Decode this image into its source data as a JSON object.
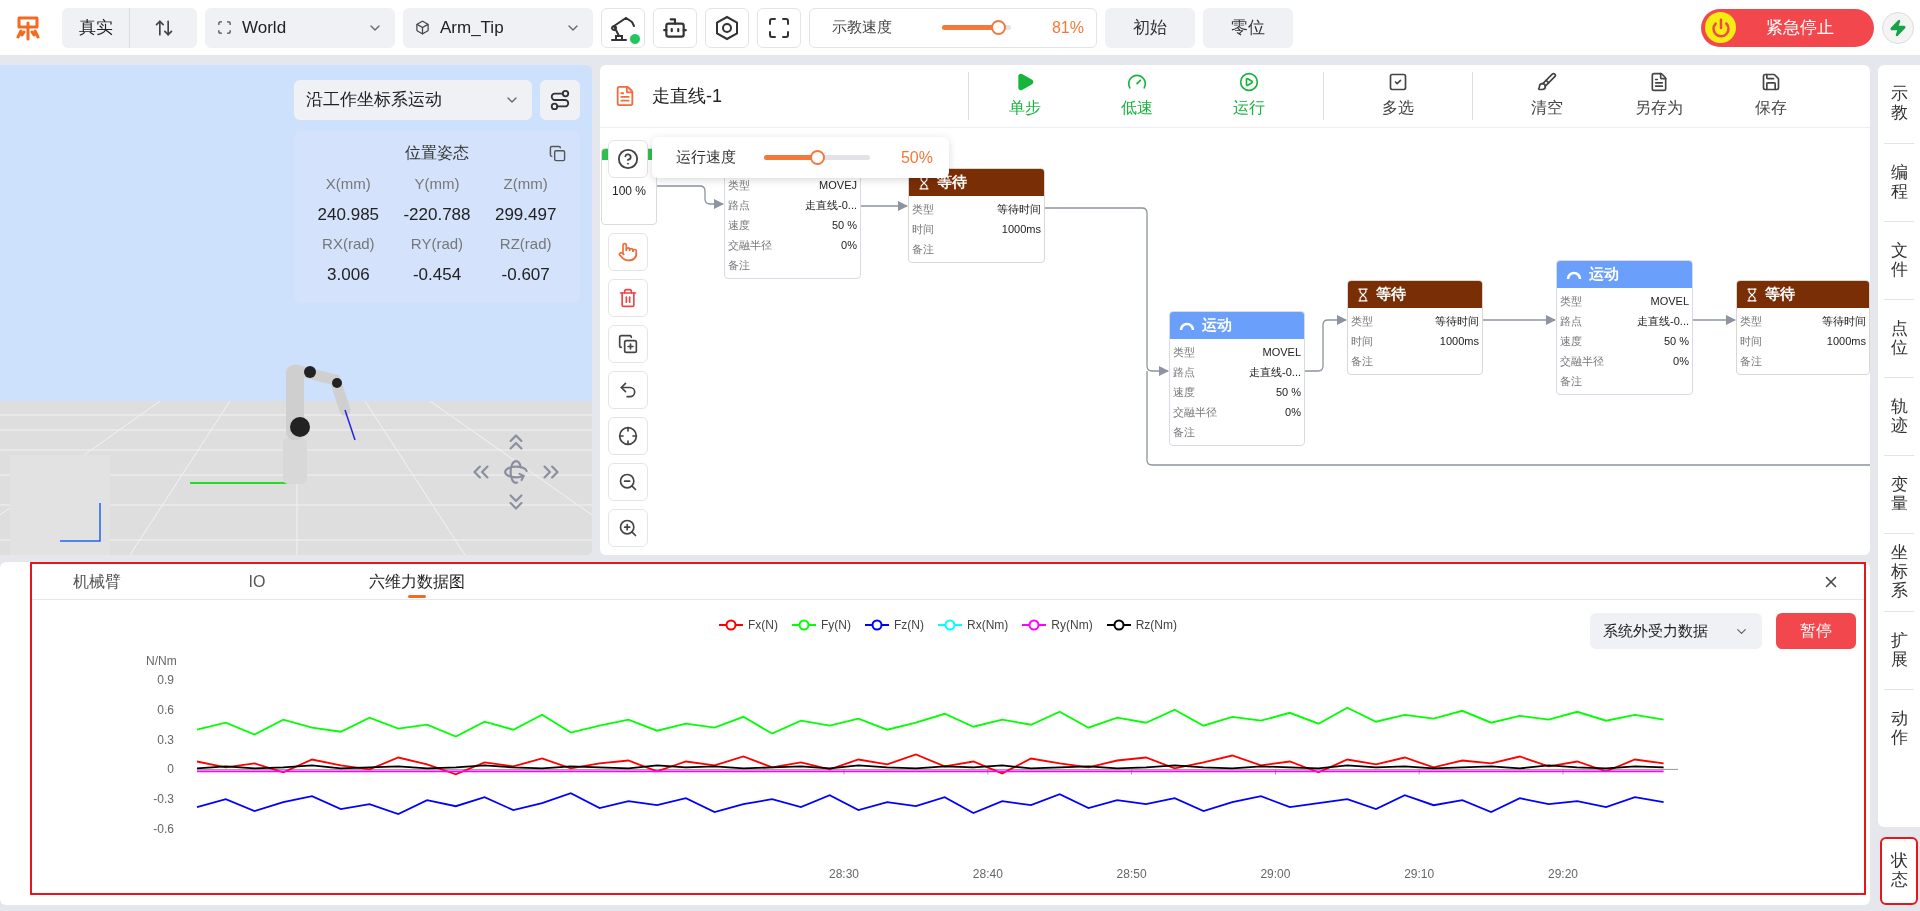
{
  "top_bar": {
    "mode_label": "真实",
    "frame_select": {
      "value": "World"
    },
    "tool_select": {
      "value": "Arm_Tip"
    },
    "robot_status": {
      "connected": true
    },
    "teach_speed": {
      "label": "示教速度",
      "level": 0.81,
      "reading": "81%"
    },
    "buttons": [
      "初始",
      "零位"
    ],
    "emergency_stop": {
      "label": "紧急停止"
    }
  },
  "viewport": {
    "kind": "picture",
    "motion_mode": {
      "value": "沿工作坐标系运动"
    },
    "pose": {
      "title": "位置姿态",
      "fields": [
        {
          "label": "X(mm)",
          "value": "240.985"
        },
        {
          "label": "Y(mm)",
          "value": "-220.788"
        },
        {
          "label": "Z(mm)",
          "value": "299.497"
        },
        {
          "label": "RX(rad)",
          "value": "3.006"
        },
        {
          "label": "RY(rad)",
          "value": "-0.454"
        },
        {
          "label": "RZ(rad)",
          "value": "-0.607"
        }
      ]
    }
  },
  "program": {
    "title": "走直线-1",
    "toolbar": [
      {
        "label": "单步",
        "kind": "run"
      },
      {
        "label": "低速",
        "kind": "run"
      },
      {
        "label": "运行",
        "kind": "run"
      },
      {
        "label": "多选",
        "kind": "select"
      },
      {
        "label": "清空",
        "kind": "file"
      },
      {
        "label": "另存为",
        "kind": "file"
      },
      {
        "label": "保存",
        "kind": "file"
      }
    ],
    "run_speed": {
      "label": "运行速度",
      "level": 0.5,
      "reading": "50%"
    },
    "start_node": {
      "reading": "100 %"
    },
    "nodes": [
      {
        "kind": "motion",
        "rows": [
          {
            "label": "类型",
            "value": "MOVEJ"
          },
          {
            "label": "路点",
            "value": "走直线-0..."
          },
          {
            "label": "速度",
            "value": "50 %"
          },
          {
            "label": "交融半径",
            "value": "0%"
          },
          {
            "label": "备注"
          }
        ]
      },
      {
        "kind": "wait",
        "title": "等待",
        "rows": [
          {
            "label": "类型",
            "value": "等待时间"
          },
          {
            "label": "时间",
            "value": "1000ms"
          },
          {
            "label": "备注"
          }
        ]
      },
      {
        "kind": "motion",
        "title": "运动",
        "rows": [
          {
            "label": "类型",
            "value": "MOVEL"
          },
          {
            "label": "路点",
            "value": "走直线-0..."
          },
          {
            "label": "速度",
            "value": "50 %"
          },
          {
            "label": "交融半径",
            "value": "0%"
          },
          {
            "label": "备注"
          }
        ]
      },
      {
        "kind": "wait",
        "title": "等待",
        "rows": [
          {
            "label": "类型",
            "value": "等待时间"
          },
          {
            "label": "时间",
            "value": "1000ms"
          },
          {
            "label": "备注"
          }
        ]
      },
      {
        "kind": "motion",
        "title": "运动",
        "rows": [
          {
            "label": "类型",
            "value": "MOVEL"
          },
          {
            "label": "路点",
            "value": "走直线-0..."
          },
          {
            "label": "速度",
            "value": "50 %"
          },
          {
            "label": "交融半径",
            "value": "0%"
          },
          {
            "label": "备注"
          }
        ]
      },
      {
        "kind": "wait",
        "title": "等待",
        "rows": [
          {
            "label": "类型",
            "value": "等待时间"
          },
          {
            "label": "时间",
            "value": "1000ms"
          },
          {
            "label": "备注"
          }
        ]
      }
    ]
  },
  "sidebar": {
    "items": [
      "示教",
      "编程",
      "文件",
      "点位",
      "轨迹",
      "变量",
      "坐标系",
      "扩展",
      "动作"
    ],
    "status_button": "状态"
  },
  "bottom_panel": {
    "tabs": [
      {
        "label": "机械臂",
        "selected": false
      },
      {
        "label": "IO",
        "selected": false
      },
      {
        "label": "六维力数据图",
        "selected": true
      }
    ],
    "source_select": {
      "value": "系统外受力数据"
    },
    "pause_button": "暂停",
    "chart_data": {
      "type": "line",
      "ylabel": "N/Nm",
      "ylim": [
        -0.6,
        0.9
      ],
      "yticks": [
        -0.6,
        -0.3,
        0,
        0.3,
        0.6,
        0.9
      ],
      "xlim": [
        1665,
        1768
      ],
      "xticks": [
        {
          "value": 1710,
          "label": "28:30"
        },
        {
          "value": 1720,
          "label": "28:40"
        },
        {
          "value": 1730,
          "label": "28:50"
        },
        {
          "value": 1740,
          "label": "29:00"
        },
        {
          "value": 1750,
          "label": "29:10"
        },
        {
          "value": 1760,
          "label": "29:20"
        }
      ],
      "x": [
        1665,
        1667,
        1669,
        1671,
        1673,
        1675,
        1677,
        1679,
        1681,
        1683,
        1685,
        1687,
        1689,
        1691,
        1693,
        1695,
        1697,
        1699,
        1701,
        1703,
        1705,
        1707,
        1709,
        1711,
        1713,
        1715,
        1717,
        1719,
        1721,
        1723,
        1725,
        1727,
        1729,
        1731,
        1733,
        1735,
        1737,
        1739,
        1741,
        1743,
        1745,
        1747,
        1749,
        1751,
        1753,
        1755,
        1757,
        1759,
        1761,
        1763,
        1765,
        1767
      ],
      "series": [
        {
          "name": "Fx(N)",
          "color": "#ff0000",
          "values": [
            0.08,
            0.02,
            0.06,
            -0.03,
            0.1,
            0.04,
            0.0,
            0.12,
            0.05,
            -0.05,
            0.07,
            0.03,
            0.11,
            0.01,
            0.06,
            0.09,
            -0.02,
            0.08,
            0.04,
            0.13,
            0.02,
            0.07,
            0.0,
            0.1,
            0.05,
            0.15,
            0.03,
            0.08,
            -0.04,
            0.11,
            0.06,
            0.02,
            0.09,
            0.12,
            0.01,
            0.07,
            0.14,
            0.04,
            0.08,
            -0.03,
            0.1,
            0.05,
            0.12,
            0.02,
            0.09,
            0.06,
            0.13,
            0.03,
            0.08,
            -0.02,
            0.1,
            0.06
          ]
        },
        {
          "name": "Fy(N)",
          "color": "#00ff00",
          "values": [
            0.4,
            0.47,
            0.35,
            0.5,
            0.42,
            0.38,
            0.52,
            0.41,
            0.45,
            0.33,
            0.48,
            0.4,
            0.55,
            0.37,
            0.44,
            0.5,
            0.39,
            0.46,
            0.42,
            0.53,
            0.36,
            0.49,
            0.44,
            0.51,
            0.4,
            0.47,
            0.56,
            0.43,
            0.5,
            0.45,
            0.58,
            0.42,
            0.52,
            0.47,
            0.6,
            0.44,
            0.53,
            0.49,
            0.57,
            0.46,
            0.62,
            0.48,
            0.55,
            0.51,
            0.59,
            0.47,
            0.54,
            0.5,
            0.58,
            0.49,
            0.55,
            0.5
          ]
        },
        {
          "name": "Fz(N)",
          "color": "#0000ff",
          "values": [
            -0.38,
            -0.3,
            -0.42,
            -0.33,
            -0.27,
            -0.4,
            -0.35,
            -0.45,
            -0.31,
            -0.37,
            -0.28,
            -0.41,
            -0.34,
            -0.24,
            -0.39,
            -0.32,
            -0.36,
            -0.29,
            -0.43,
            -0.35,
            -0.3,
            -0.38,
            -0.26,
            -0.41,
            -0.33,
            -0.37,
            -0.28,
            -0.44,
            -0.32,
            -0.36,
            -0.25,
            -0.39,
            -0.31,
            -0.35,
            -0.29,
            -0.42,
            -0.33,
            -0.27,
            -0.38,
            -0.34,
            -0.3,
            -0.4,
            -0.26,
            -0.36,
            -0.31,
            -0.43,
            -0.29,
            -0.35,
            -0.32,
            -0.38,
            -0.28,
            -0.33
          ]
        },
        {
          "name": "Rx(Nm)",
          "color": "#00ffff",
          "values": [
            null,
            null,
            null,
            null,
            null,
            null,
            null,
            null,
            null,
            null,
            null,
            null,
            null,
            null,
            null,
            null,
            null,
            null,
            null,
            null,
            null,
            null,
            null,
            null,
            null,
            null,
            null,
            null,
            null,
            null,
            null,
            null,
            null,
            null,
            null,
            null,
            null,
            null,
            null,
            null,
            null,
            null,
            null,
            null,
            null,
            null,
            null,
            null,
            null,
            null,
            null,
            null
          ]
        },
        {
          "name": "Ry(Nm)",
          "color": "#ff00ff",
          "values": [
            -0.02,
            -0.02,
            -0.02,
            -0.02,
            -0.02,
            -0.02,
            -0.02,
            -0.02,
            -0.02,
            -0.02,
            -0.02,
            -0.02,
            -0.02,
            -0.02,
            -0.02,
            -0.02,
            -0.02,
            -0.02,
            -0.02,
            -0.02,
            -0.02,
            -0.02,
            -0.02,
            -0.02,
            -0.02,
            -0.02,
            -0.02,
            -0.02,
            -0.02,
            -0.02,
            -0.02,
            -0.02,
            -0.02,
            -0.02,
            -0.02,
            -0.02,
            -0.02,
            -0.02,
            -0.02,
            -0.02,
            -0.02,
            -0.02,
            -0.02,
            -0.02,
            -0.02,
            -0.02,
            -0.02,
            -0.02,
            -0.02,
            -0.02,
            -0.02,
            -0.02
          ]
        },
        {
          "name": "Rz(Nm)",
          "color": "#000000",
          "values": [
            0.01,
            0.03,
            0.01,
            0.02,
            0.04,
            0.01,
            0.02,
            0.03,
            0.01,
            0.02,
            0.04,
            0.02,
            0.01,
            0.03,
            0.02,
            0.01,
            0.04,
            0.02,
            0.03,
            0.01,
            0.02,
            0.03,
            0.01,
            0.04,
            0.02,
            0.01,
            0.03,
            0.02,
            0.04,
            0.01,
            0.02,
            0.03,
            0.01,
            0.02,
            0.04,
            0.02,
            0.01,
            0.03,
            0.02,
            0.01,
            0.04,
            0.02,
            0.03,
            0.01,
            0.02,
            0.03,
            0.01,
            0.04,
            0.02,
            0.01,
            0.03,
            0.02
          ]
        }
      ]
    }
  }
}
